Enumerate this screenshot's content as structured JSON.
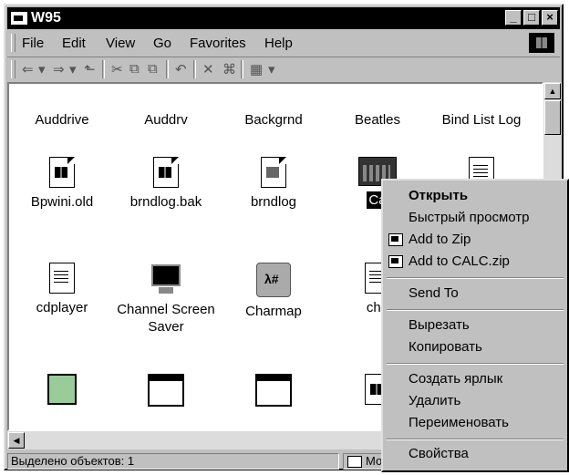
{
  "window": {
    "title": "W95"
  },
  "title_buttons": {
    "minimize": "_",
    "maximize": "□",
    "close": "×"
  },
  "menubar": [
    "File",
    "Edit",
    "View",
    "Go",
    "Favorites",
    "Help"
  ],
  "toolbar": [
    "⇐",
    "▾",
    "⇒",
    "▾",
    "⬑",
    "✂",
    "⧉",
    "⧉",
    "↶",
    "✕",
    "⌘",
    "▦",
    "▾"
  ],
  "icons_row1": [
    "Auddrive",
    "Auddrv",
    "Backgrnd",
    "Beatles",
    "Bind List Log"
  ],
  "icons_row2": [
    "Bpwini.old",
    "brndlog.bak",
    "brndlog",
    "Ca"
  ],
  "icons_row3": [
    "cdplayer",
    "Channel Screen Saver",
    "Charmap",
    "che"
  ],
  "scrollbar": {
    "up": "▲",
    "down": "▼",
    "left": "◀"
  },
  "status": {
    "left": "Выделено объектов: 1",
    "right": "Мой компьютер"
  },
  "context_menu": {
    "open": "Открыть",
    "quick_view": "Быстрый просмотр",
    "add_zip": "Add to Zip",
    "add_calc_zip": "Add to CALC.zip",
    "send_to": "Send To",
    "cut": "Вырезать",
    "copy": "Копировать",
    "create_shortcut": "Создать ярлык",
    "delete": "Удалить",
    "rename": "Переименовать",
    "properties": "Свойства"
  }
}
